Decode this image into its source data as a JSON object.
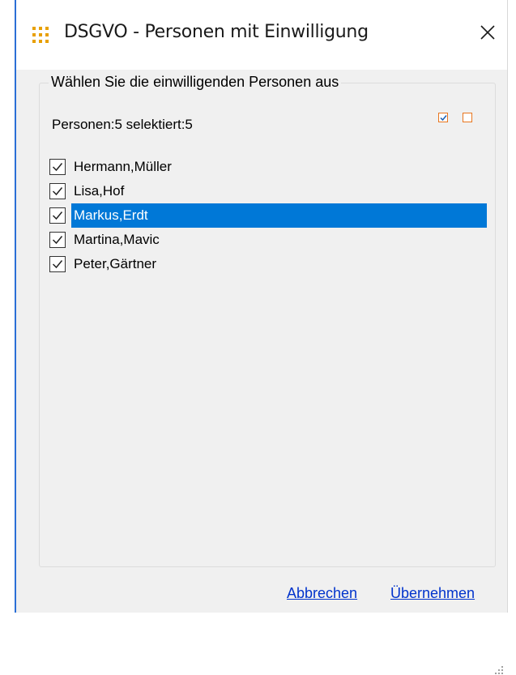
{
  "window": {
    "title": "DSGVO - Personen mit Einwilligung",
    "app_icon": "app-grid-icon",
    "close_icon": "close-icon"
  },
  "group": {
    "legend": "Wählen Sie die einwilligenden Personen aus",
    "count_label": "Personen:5 selektiert:5",
    "select_all_icon": "check-all-icon",
    "select_none_icon": "uncheck-all-icon"
  },
  "persons": [
    {
      "label": "Hermann,Müller",
      "checked": true,
      "selected": false
    },
    {
      "label": "Lisa,Hof",
      "checked": true,
      "selected": false
    },
    {
      "label": "Markus,Erdt",
      "checked": true,
      "selected": true
    },
    {
      "label": "Martina,Mavic",
      "checked": true,
      "selected": false
    },
    {
      "label": "Peter,Gärtner",
      "checked": true,
      "selected": false
    }
  ],
  "actions": {
    "cancel": "Abbrechen",
    "apply": "Übernehmen"
  },
  "colors": {
    "selection": "#0078d7",
    "accent_orange": "#e8761f",
    "link": "#0033cc",
    "icon_yellow": "#e8a000"
  }
}
